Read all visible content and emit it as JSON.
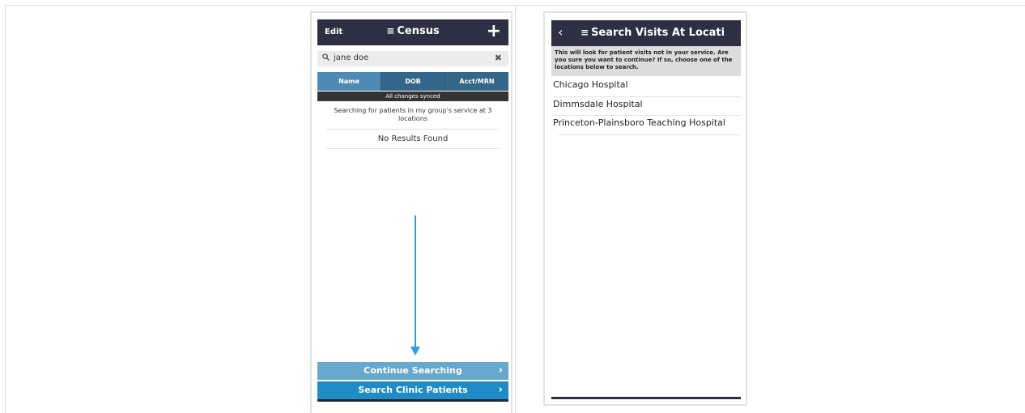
{
  "census": {
    "header": {
      "edit_label": "Edit",
      "title": "Census",
      "list_icon": "≡",
      "add_icon": "+"
    },
    "search": {
      "query": "jane doe",
      "search_icon": "🔍",
      "clear_icon": "✖"
    },
    "tabs": [
      {
        "label": "Name",
        "active": true
      },
      {
        "label": "DOB",
        "active": false
      },
      {
        "label": "Acct/MRN",
        "active": false
      }
    ],
    "sync_status": "All changes synced",
    "info_text": "Searching for patients in my group's service at 3 locations",
    "no_results": "No Results Found",
    "buttons": {
      "continue_label": "Continue Searching",
      "clinic_label": "Search Clinic Patients",
      "chevron": "›"
    },
    "colors": {
      "header": "#2f2f43",
      "tab_active": "#4d8ab4",
      "tab_inactive": "#336688",
      "arrow": "#2ca3d8",
      "continue": "#66a9cc",
      "clinic": "#1f8cc7"
    }
  },
  "search_visits": {
    "header": {
      "back_icon": "‹",
      "title": "Search Visits At Locati",
      "list_icon": "≡"
    },
    "warning": "This will look for patient visits not in your service. Are you sure you want to continue? If so, choose one of the locations below to search.",
    "locations": [
      "Chicago Hospital",
      "Dimmsdale Hospital",
      "Princeton-Plainsboro Teaching Hospital"
    ]
  }
}
